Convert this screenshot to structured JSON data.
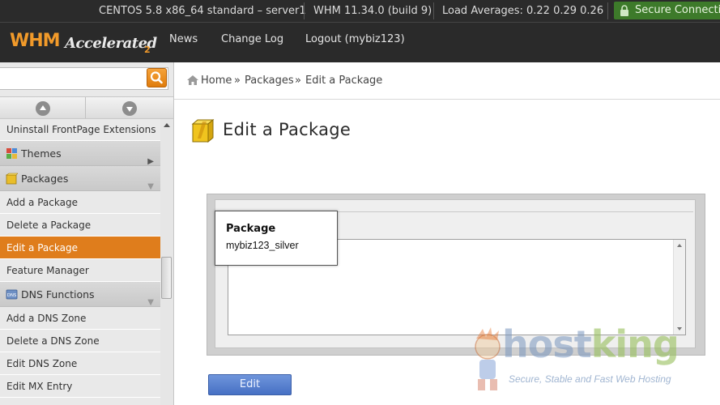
{
  "status_bar": {
    "server": "CENTOS 5.8 x86_64 standard – server1",
    "version": "WHM 11.34.0 (build 9)",
    "load": "Load Averages: 0.22 0.29 0.26",
    "secure": "Secure Connection"
  },
  "header": {
    "logo_whm": "WHM",
    "logo_accelerated": "Accelerated",
    "logo_2": "2",
    "nav": [
      "News",
      "Change Log",
      "Logout (mybiz123)"
    ]
  },
  "sidebar": {
    "search_placeholder": "",
    "items": [
      {
        "label": "Uninstall FrontPage Extensions",
        "kind": "item"
      },
      {
        "label": "Themes",
        "kind": "category",
        "icon": "themes-icon",
        "arrow": "right"
      },
      {
        "label": "Packages",
        "kind": "category",
        "icon": "package-icon",
        "arrow": "down"
      },
      {
        "label": "Add a Package",
        "kind": "item"
      },
      {
        "label": "Delete a Package",
        "kind": "item"
      },
      {
        "label": "Edit a Package",
        "kind": "item",
        "active": true
      },
      {
        "label": "Feature Manager",
        "kind": "item"
      },
      {
        "label": "DNS Functions",
        "kind": "category",
        "icon": "dns-icon",
        "arrow": "down"
      },
      {
        "label": "Add a DNS Zone",
        "kind": "item"
      },
      {
        "label": "Delete a DNS Zone",
        "kind": "item"
      },
      {
        "label": "Edit DNS Zone",
        "kind": "item"
      },
      {
        "label": "Edit MX Entry",
        "kind": "item"
      }
    ]
  },
  "breadcrumb": {
    "items": [
      "Home",
      "Packages",
      "Edit a Package"
    ],
    "separator": "»"
  },
  "main": {
    "title": "Edit a Package",
    "package_label": "Package",
    "package_options": [
      "mybiz123_silver"
    ],
    "edit_button": "Edit"
  },
  "watermark": {
    "brand_host": "host",
    "brand_king": "king",
    "tagline": "Secure, Stable and Fast Web Hosting"
  },
  "colors": {
    "accent_orange": "#df7d1c",
    "header_bg": "#2a2a2a",
    "edit_button": "#5580d0",
    "secure_green": "#3d7a2a"
  }
}
